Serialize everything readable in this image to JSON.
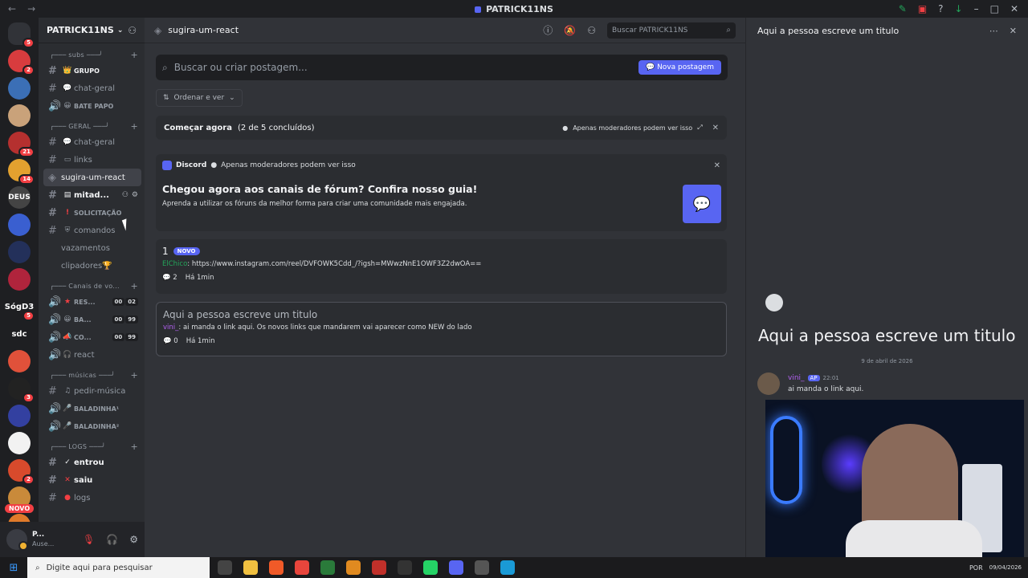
{
  "window": {
    "title": "PATRICK11NS"
  },
  "servers": [
    {
      "label": "",
      "badge": "5",
      "color": "#5865f2"
    },
    {
      "label": "",
      "badge": "2",
      "color": "#d83c3e"
    },
    {
      "label": "",
      "badge": "",
      "color": "#3b6fb6"
    },
    {
      "label": "",
      "badge": "",
      "color": "#c9a27a"
    },
    {
      "label": "",
      "badge": "21",
      "color": "#b5302f"
    },
    {
      "label": "",
      "badge": "14",
      "color": "#e3a12f"
    },
    {
      "label": "DEUS",
      "badge": "",
      "color": "#444"
    },
    {
      "label": "",
      "badge": "",
      "color": "#3a5fd0"
    },
    {
      "label": "",
      "badge": "",
      "color": "#23305a"
    },
    {
      "label": "",
      "badge": "",
      "color": "#b0243c"
    },
    {
      "label": "SógD3",
      "badge": "5",
      "color": "transparent"
    },
    {
      "label": "sdc",
      "badge": "",
      "color": "transparent"
    },
    {
      "label": "",
      "badge": "",
      "color": "#e0513a"
    },
    {
      "label": "",
      "badge": "3",
      "color": "#222"
    },
    {
      "label": "",
      "badge": "",
      "color": "#3340a0"
    },
    {
      "label": "",
      "badge": "",
      "color": "#f2f2f2"
    },
    {
      "label": "",
      "badge": "2",
      "color": "#d84a2c"
    },
    {
      "label": "",
      "badge": "",
      "color": "#c98a3a"
    },
    {
      "label": "",
      "badge": "",
      "color": "#e07a2a"
    }
  ],
  "novo_pill": "NOVO",
  "guild": {
    "name": "PATRICK11NS"
  },
  "sidebar": {
    "subs_cat": "╭─── subs ───╯",
    "grupo": "GRUPO",
    "chat_geral_1": "chat-geral",
    "bate_papo": "BATE PAPO",
    "geral_cat": "╭─── GERAL ───╯",
    "chat_geral_2": "chat-geral",
    "links": "links",
    "forum": "sugira-um-react",
    "mitad": "mitad...",
    "solic": "SOLICITAÇÃO",
    "comandos": "comandos",
    "vazamentos": "vazamentos",
    "clipadores": "clipadores🏆",
    "voice_cat": "╭─── Canais de vo...",
    "res": "RES...",
    "res_cnt": [
      "00",
      "02"
    ],
    "ba": "BA...",
    "ba_cnt": [
      "00",
      "99"
    ],
    "co": "CO...",
    "co_cnt": [
      "00",
      "99"
    ],
    "react": "react",
    "musicas_cat": "╭─── músicas ───╯",
    "pedir": "pedir-música",
    "baladinha1": "BALADINHA¹",
    "baladinha2": "BALADINHA²",
    "logs_cat": "╭─── LOGS ───╯",
    "entrou": "entrou",
    "saiu": "saiu",
    "logs": "logs"
  },
  "user": {
    "name": "P...",
    "status": "Ause..."
  },
  "header": {
    "channel": "sugira-um-react",
    "search_placeholder": "Buscar PATRICK11NS"
  },
  "forum": {
    "search_placeholder": "Buscar ou criar postagem...",
    "new_post": "Nova postagem",
    "sort": "Ordenar e ver",
    "getting_started": "Começar agora",
    "getting_progress": "(2 de 5 concluídos)",
    "mods_only": "Apenas moderadores podem ver isso",
    "discord_label": "Discord",
    "guide_title": "Chegou agora aos canais de fórum? Confira nosso guia!",
    "guide_sub": "Aprenda a utilizar os fóruns da melhor forma para criar uma comunidade mais engajada.",
    "post1_title": "1",
    "post1_new": "NOVO",
    "post1_author": "ElChico",
    "post1_text": ": https://www.instagram.com/reel/DVFOWK5Cdd_/?igsh=MWwzNnE1OWF3Z2dwOA==",
    "post1_replies": "2",
    "post1_time": "Há 1min",
    "post2_title": "Aqui a pessoa escreve um titulo",
    "post2_author": "vini_",
    "post2_text": ": ai manda o link aqui. Os novos links que mandarem vai aparecer como NEW do lado",
    "post2_replies": "0",
    "post2_time": "Há 1min"
  },
  "thread": {
    "header": "Aqui a pessoa escreve um titulo",
    "title": "Aqui a pessoa escreve um titulo",
    "date": "9 de abril de 2026",
    "author": "vini_",
    "tag": "AP",
    "time": "22:01",
    "message": "ai manda o link aqui."
  },
  "taskbar": {
    "search": "Digite aqui para pesquisar",
    "lang": "POR",
    "date": "09/04/2026"
  }
}
